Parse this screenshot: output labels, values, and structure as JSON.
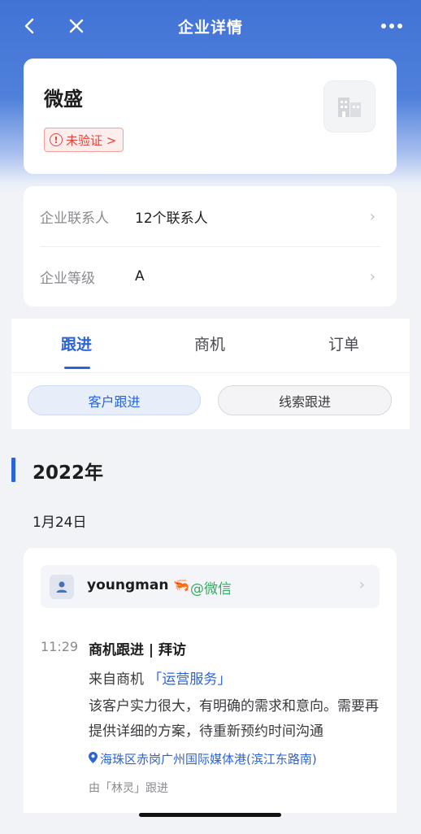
{
  "nav": {
    "title": "企业详情"
  },
  "company": {
    "name": "微盛",
    "verify_label": "未验证 >"
  },
  "info": {
    "rows": [
      {
        "label": "企业联系人",
        "value": "12个联系人"
      },
      {
        "label": "企业等级",
        "value": "A"
      }
    ]
  },
  "tabs": [
    {
      "label": "跟进",
      "active": true
    },
    {
      "label": "商机",
      "active": false
    },
    {
      "label": "订单",
      "active": false
    }
  ],
  "segments": [
    {
      "label": "客户跟进",
      "active": true
    },
    {
      "label": "线索跟进",
      "active": false
    }
  ],
  "timeline": {
    "year": "2022年",
    "date": "1月24日"
  },
  "record": {
    "user_name": "youngman",
    "user_emoji": "🦐",
    "user_source": "@微信",
    "time": "11:29",
    "title": "商机跟进 | 拜访",
    "from_prefix": "来自商机",
    "from_link": "「运营服务」",
    "body": "该客户实力很大，有明确的需求和意向。需要再提供详细的方案，待重新预约时间沟通",
    "location": "海珠区赤岗广州国际媒体港(滨江东路南)",
    "owner": "由「林灵」跟进"
  },
  "colors": {
    "primary": "#2c64d7",
    "header": "#4173d6",
    "danger": "#e0463c",
    "wechat_green": "#3aa865"
  },
  "icons": [
    "back-icon",
    "close-icon",
    "more-icon",
    "alert-icon",
    "building-icon",
    "chevron-right-icon",
    "user-icon",
    "location-pin-icon"
  ]
}
